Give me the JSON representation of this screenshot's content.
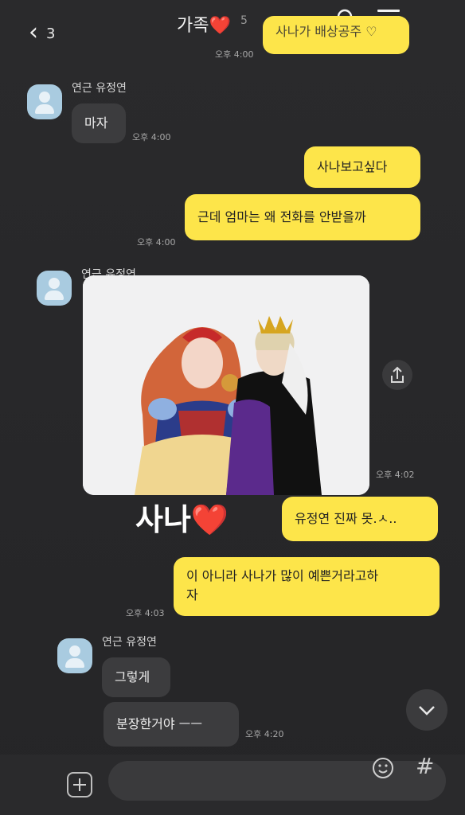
{
  "header": {
    "back_count": "3",
    "title": "가족",
    "heart": "❤️",
    "member_hint": "5"
  },
  "top_partial": {
    "text": "사나가 배상공주 ♡",
    "time": "오후 4:00"
  },
  "messages": {
    "m1": {
      "sender": "연근 유정연",
      "text": "마자",
      "time": "오후 4:00"
    },
    "m2": {
      "text": "사나보고싶다"
    },
    "m3": {
      "text": "근데 엄마는 왜 전화를 안받을까",
      "time": "오후 4:00"
    },
    "m4": {
      "sender": "연근 유정연",
      "time": "오후 4:02"
    },
    "m5": {
      "text": "유정연 진짜 못.ㅅ..",
      "time": ""
    },
    "m6": {
      "line1": "이 아니라 사나가 많이 예쁜거라고하",
      "line2": "자",
      "time": "오후 4:03"
    },
    "m7": {
      "sender": "연근 유정연",
      "text": "그렇게"
    },
    "m8": {
      "text": "분장한거야 ㅡㅡ",
      "time": "오후 4:20"
    }
  },
  "overlay_caption": {
    "text": "사나",
    "heart": "❤️"
  },
  "colors": {
    "out_bubble": "#fde54a",
    "in_bubble": "#3c3c3e",
    "background": "#262628"
  },
  "icons": [
    "back-icon",
    "search-icon",
    "menu-icon",
    "share-icon",
    "chevron-down-icon",
    "plus-icon",
    "emoji-icon",
    "hash-icon"
  ]
}
